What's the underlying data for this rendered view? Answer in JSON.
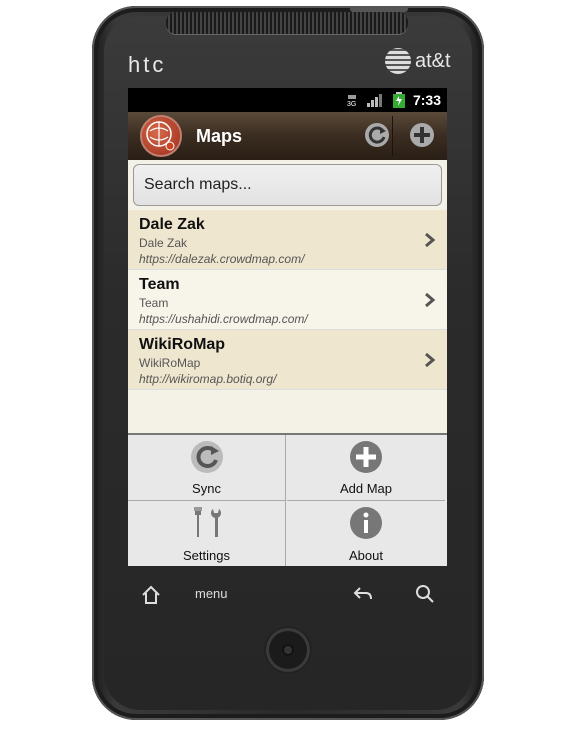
{
  "device": {
    "brand_left": "htc",
    "brand_right": "at&t"
  },
  "status_bar": {
    "time": "7:33",
    "signal_icon": "signal-3g-icon",
    "battery_icon": "battery-icon"
  },
  "app_bar": {
    "title": "Maps",
    "logo_icon": "crowdmap-logo-icon",
    "refresh_icon": "refresh-icon",
    "add_icon": "add-icon"
  },
  "search": {
    "placeholder": "Search maps..."
  },
  "maps": [
    {
      "title": "Dale Zak",
      "subtitle": "Dale Zak",
      "url": "https://dalezak.crowdmap.com/"
    },
    {
      "title": "Team",
      "subtitle": "Team",
      "url": "https://ushahidi.crowdmap.com/"
    },
    {
      "title": "WikiRoMap",
      "subtitle": "WikiRoMap",
      "url": "http://wikiromap.botiq.org/"
    }
  ],
  "menu": {
    "sync": "Sync",
    "add_map": "Add Map",
    "settings": "Settings",
    "about": "About"
  },
  "nav_keys": {
    "menu": "menu"
  },
  "colors": {
    "title_bar": "#3a2c20",
    "list_alt": "#efe6cf",
    "accent_logo": "#9a2a1a"
  }
}
